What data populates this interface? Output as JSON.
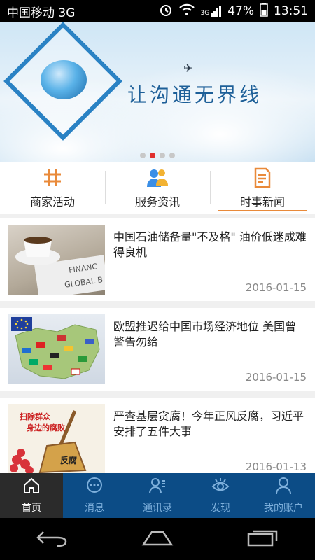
{
  "status_bar": {
    "carrier": "中国移动 3G",
    "network": "3G",
    "battery": "47%",
    "time": "13:51"
  },
  "banner": {
    "slogan": "让沟通无界线",
    "slide_count": 4,
    "active_slide": 1
  },
  "tabs": [
    {
      "label": "商家活动",
      "icon": "hash-icon",
      "active": false
    },
    {
      "label": "服务资讯",
      "icon": "people-icon",
      "active": false
    },
    {
      "label": "时事新闻",
      "icon": "document-icon",
      "active": true
    }
  ],
  "news": [
    {
      "title": "中国石油储备量\"不及格\" 油价低迷成难得良机",
      "date": "2016-01-15",
      "thumb_text": [
        "FINANC",
        "GLOBAL B"
      ]
    },
    {
      "title": "欧盟推迟给中国市场经济地位 美国曾警告勿给",
      "date": "2016-01-15",
      "thumb_text": []
    },
    {
      "title": "严查基层贪腐！今年正风反腐，习近平安排了五件大事",
      "date": "2016-01-13",
      "thumb_text": [
        "扫除群众",
        "身边的腐败",
        "反腐"
      ]
    }
  ],
  "bottom_nav": [
    {
      "label": "首页",
      "icon": "home-icon",
      "active": true
    },
    {
      "label": "消息",
      "icon": "chat-icon",
      "active": false
    },
    {
      "label": "通讯录",
      "icon": "contacts-icon",
      "active": false
    },
    {
      "label": "发现",
      "icon": "eye-icon",
      "active": false
    },
    {
      "label": "我的账户",
      "icon": "user-icon",
      "active": false
    }
  ],
  "colors": {
    "accent": "#e98a3a",
    "tabbar_bg": "#0c4c86",
    "tabbar_active_bg": "#2b2b2b",
    "slide_dot_active": "#e0302f"
  }
}
